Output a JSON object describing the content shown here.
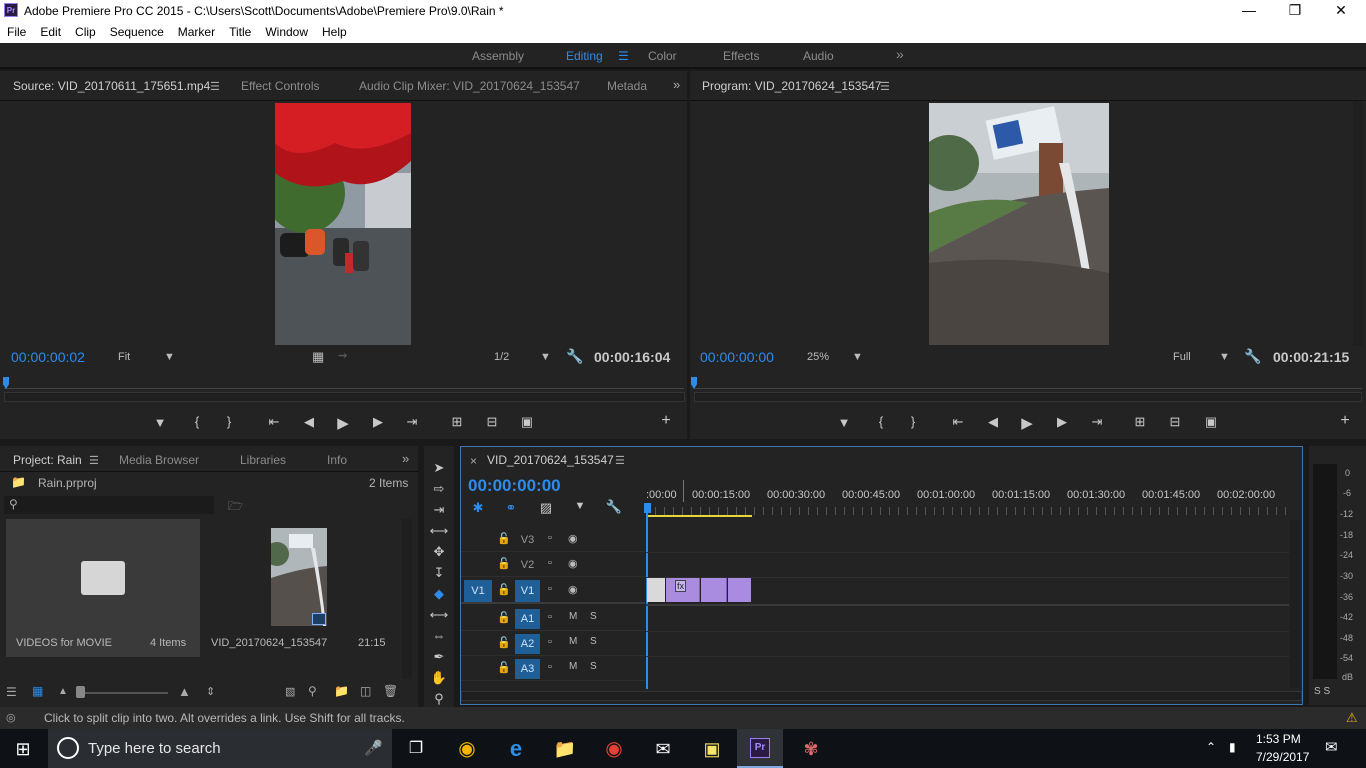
{
  "window": {
    "title": "Adobe Premiere Pro CC 2015 - C:\\Users\\Scott\\Documents\\Adobe\\Premiere Pro\\9.0\\Rain *",
    "app_icon": "Pr"
  },
  "menu": [
    "File",
    "Edit",
    "Clip",
    "Sequence",
    "Marker",
    "Title",
    "Window",
    "Help"
  ],
  "workspaces": {
    "items": [
      "Assembly",
      "Editing",
      "Color",
      "Effects",
      "Audio"
    ],
    "active": "Editing",
    "overflow": "»"
  },
  "source": {
    "tabs": [
      "Source: VID_20170611_175651.mp4",
      "Effect Controls",
      "Audio Clip Mixer: VID_20170624_153547",
      "Metada"
    ],
    "timecode": "00:00:00:02",
    "zoom": "Fit",
    "resolution": "1/2",
    "duration": "00:00:16:04"
  },
  "program": {
    "tab": "Program: VID_20170624_153547",
    "timecode": "00:00:00:00",
    "zoom": "25%",
    "resolution": "Full",
    "duration": "00:00:21:15"
  },
  "project": {
    "tabs": [
      "Project: Rain",
      "Media Browser",
      "Libraries",
      "Info"
    ],
    "file": "Rain.prproj",
    "count": "2 Items",
    "items": [
      {
        "name": "VIDEOS for MOVIE",
        "meta": "4 Items"
      },
      {
        "name": "VID_20170624_153547",
        "meta": "21:15"
      }
    ]
  },
  "timeline": {
    "tab": "VID_20170624_153547",
    "close": "×",
    "timecode": "00:00:00:00",
    "ticks": [
      ":00:00",
      "00:00:15:00",
      "00:00:30:00",
      "00:00:45:00",
      "00:01:00:00",
      "00:01:15:00",
      "00:01:30:00",
      "00:01:45:00",
      "00:02:00:00"
    ],
    "video_tracks": [
      "V3",
      "V2",
      "V1"
    ],
    "audio_tracks": [
      "A1",
      "A2",
      "A3"
    ],
    "source_patch": "V1",
    "m_label": "M",
    "s_label": "S",
    "clip_badge": "fx"
  },
  "meter": {
    "labels": [
      "0",
      "-6",
      "-12",
      "-18",
      "-24",
      "-30",
      "-36",
      "-42",
      "-48",
      "-54",
      "dB"
    ],
    "solo": "S S"
  },
  "status": "Click to split clip into two. Alt overrides a link. Use Shift for all tracks.",
  "taskbar": {
    "search_placeholder": "Type here to search",
    "time": "1:53 PM",
    "date": "7/29/2017"
  },
  "colors": {
    "accent": "#2d8ceb",
    "clip": "#a98be0",
    "track_active": "#1e5f98"
  }
}
